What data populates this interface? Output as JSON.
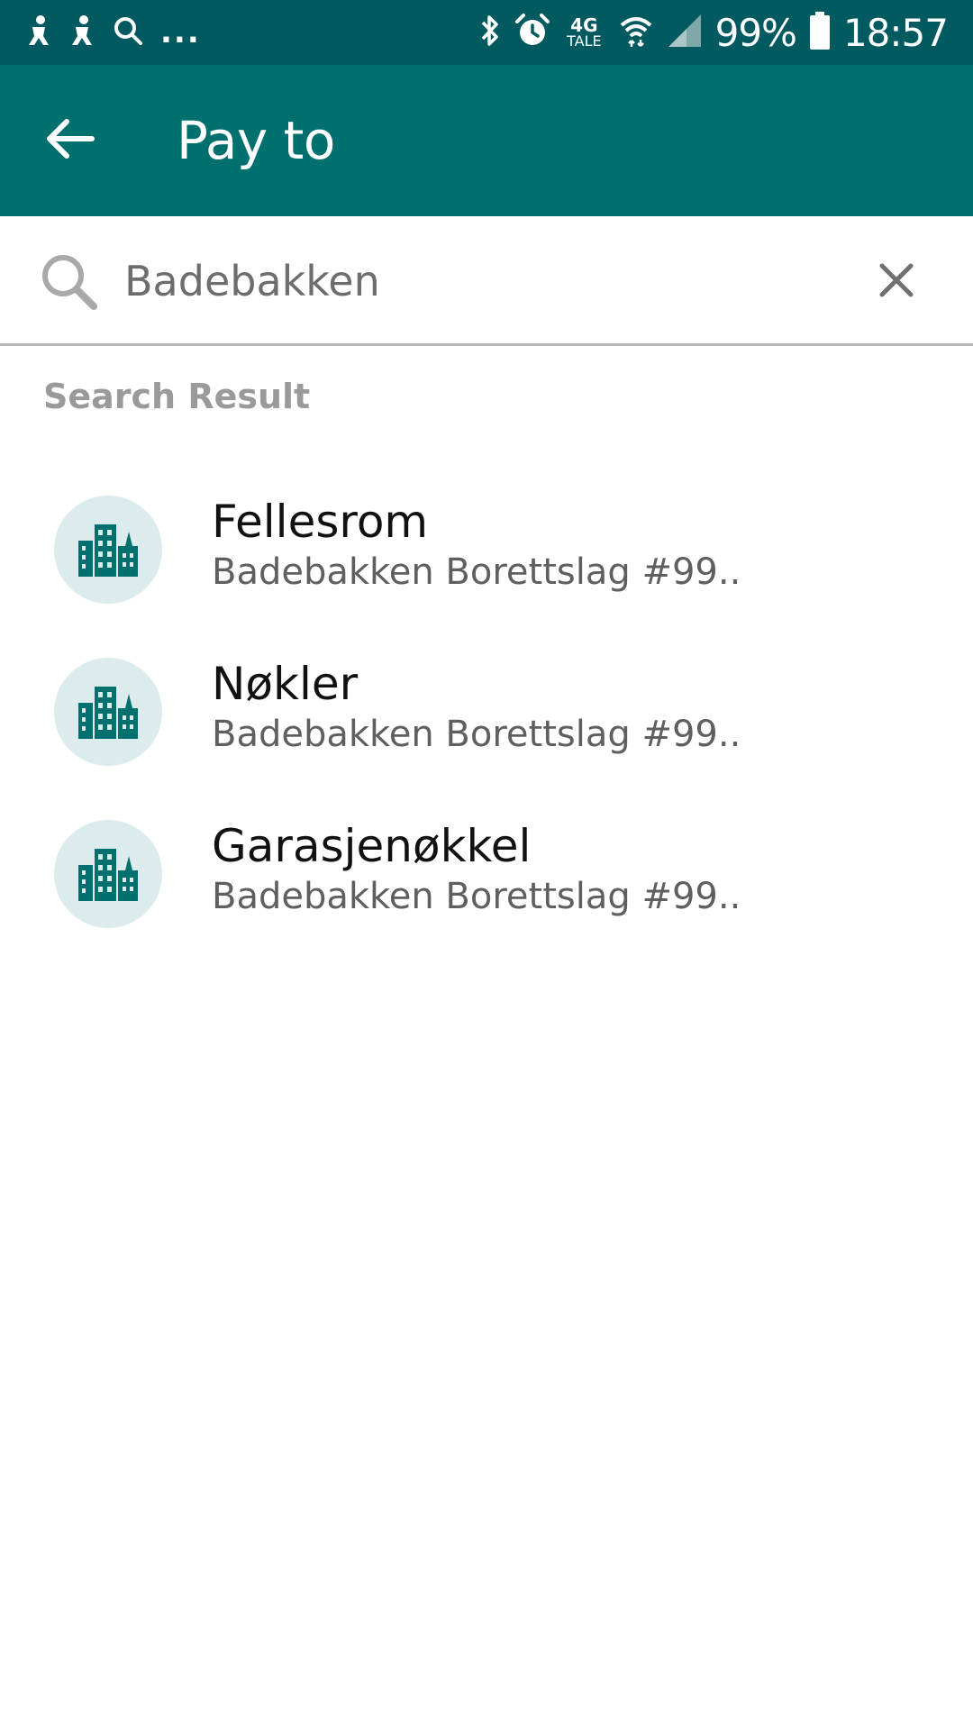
{
  "status_bar": {
    "network_top": "4G",
    "network_bottom": "TALE",
    "battery_percent": "99%",
    "time": "18:57",
    "left_overflow": "...",
    "icons": [
      "notification-icon",
      "notification-icon",
      "search-icon",
      "bluetooth-icon",
      "alarm-icon",
      "wifi-icon",
      "signal-icon",
      "battery-icon"
    ]
  },
  "app_bar": {
    "title": "Pay to",
    "back_icon": "arrow-left-icon"
  },
  "search": {
    "value": "Badebakken",
    "search_icon": "search-icon",
    "clear_icon": "close-icon"
  },
  "section": {
    "label": "Search Result"
  },
  "results": [
    {
      "title": "Fellesrom",
      "subtitle": "Badebakken Borettslag #99..",
      "icon": "building-icon"
    },
    {
      "title": "Nøkler",
      "subtitle": "Badebakken Borettslag #99..",
      "icon": "building-icon"
    },
    {
      "title": "Garasjenøkkel",
      "subtitle": "Badebakken Borettslag #99..",
      "icon": "building-icon"
    }
  ],
  "colors": {
    "status_bar": "#005a5f",
    "app_bar": "#00706f",
    "avatar_bg": "#dcebeb",
    "icon_teal": "#00706f"
  }
}
